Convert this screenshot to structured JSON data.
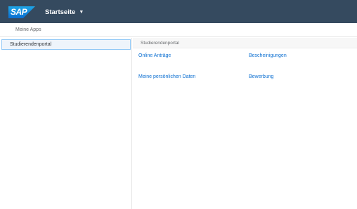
{
  "shell": {
    "logo_text": "SAP",
    "title": "Startseite",
    "caret_icon": "chevron-down-icon",
    "background": "#354a5f"
  },
  "subheader": {
    "label": "Meine Apps"
  },
  "sidebar": {
    "items": [
      {
        "label": "Studierendenportal",
        "selected": true
      }
    ]
  },
  "main": {
    "group_title": "Studierendenportal",
    "links": [
      {
        "label": "Online Anträge"
      },
      {
        "label": "Bescheinigungen"
      },
      {
        "label": "Meine persönlichen Daten"
      },
      {
        "label": "Bewerbung"
      }
    ],
    "link_color": "#0a6ed1"
  }
}
